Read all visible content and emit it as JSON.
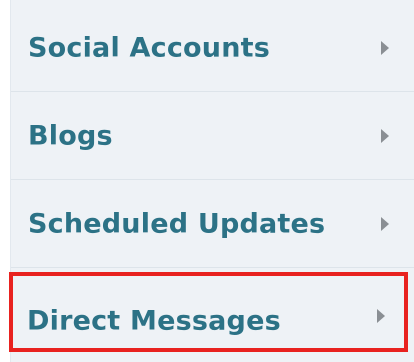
{
  "menu": {
    "items": [
      {
        "label": "Social Accounts",
        "icon": "chevron-right-icon"
      },
      {
        "label": "Blogs",
        "icon": "chevron-right-icon"
      },
      {
        "label": "Scheduled Updates",
        "icon": "chevron-right-icon"
      },
      {
        "label": "Direct Messages",
        "icon": "chevron-right-icon",
        "highlighted": true
      }
    ]
  },
  "colors": {
    "background": "#eef2f6",
    "label": "#2c7286",
    "chevron": "#8a8f94",
    "highlight_border": "#e8221f"
  }
}
